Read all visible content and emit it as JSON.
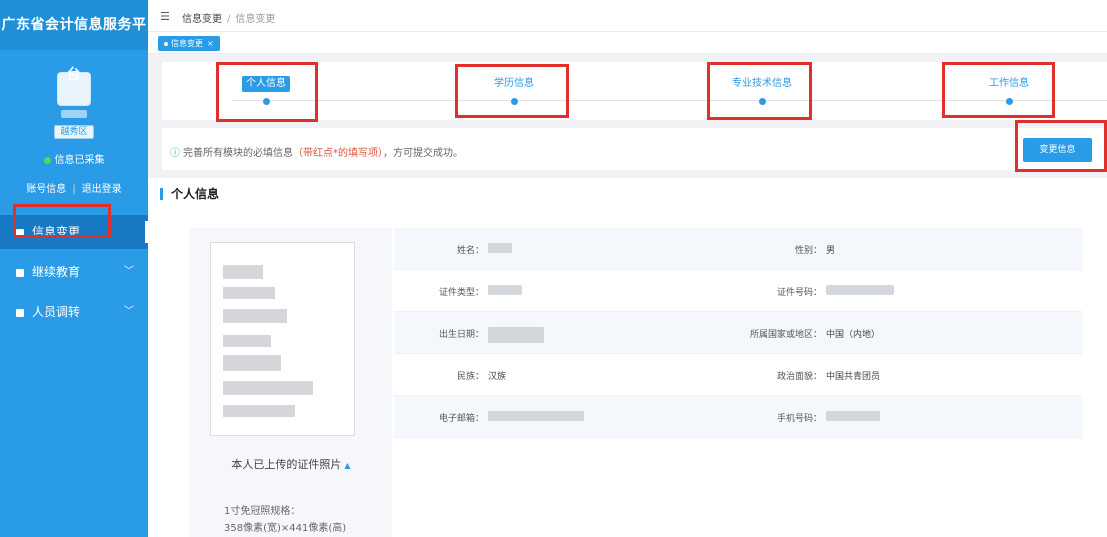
{
  "app": {
    "brand": "广东省会计信息服务平台"
  },
  "sidebar": {
    "region": "越秀区",
    "status": "信息已采集",
    "account": "账号信息",
    "logout": "退出登录",
    "account_sep": "|",
    "menu": [
      {
        "label": "信息变更",
        "active": true
      },
      {
        "label": "继续教育"
      },
      {
        "label": "人员调转"
      }
    ]
  },
  "topbar": {
    "breadcrumb": [
      "信息变更",
      "信息变更"
    ],
    "breadcrumb_sep": "/"
  },
  "tabs": [
    {
      "label": "信息变更",
      "close": "×"
    }
  ],
  "steps": [
    {
      "label": "个人信息",
      "active": true
    },
    {
      "label": "学历信息"
    },
    {
      "label": "专业技术信息"
    },
    {
      "label": "工作信息"
    }
  ],
  "notice": {
    "icon": "ⓘ",
    "prefix": "完善所有模块的必填信息",
    "warn": "（带红点*的填写项）",
    "suffix": "，方可提交成功。"
  },
  "change_button": "变更信息",
  "panel": {
    "title": "个人信息",
    "photo_caption": "本人已上传的证件照片",
    "photo_caption_icon": "▲",
    "spec_line1": "1寸免冠照规格：",
    "spec_line2": "358像素(宽)×441像素(高)",
    "fields": [
      {
        "label": "姓名：",
        "value": "",
        "label2": "性别：",
        "value2": "男"
      },
      {
        "label": "证件类型：",
        "value": "",
        "label2": "证件号码：",
        "value2": ""
      },
      {
        "label": "出生日期：",
        "value": "",
        "label2": "所属国家或地区：",
        "value2": "中国（内地）"
      },
      {
        "label": "民族：",
        "value": "汉族",
        "label2": "政治面貌：",
        "value2": "中国共青团员"
      },
      {
        "label": "电子邮箱：",
        "value": "",
        "label2": "手机号码：",
        "value2": ""
      }
    ]
  },
  "colors": {
    "primary": "#2a9be6",
    "annotation": "#e0302c",
    "warn": "#e0543b"
  }
}
